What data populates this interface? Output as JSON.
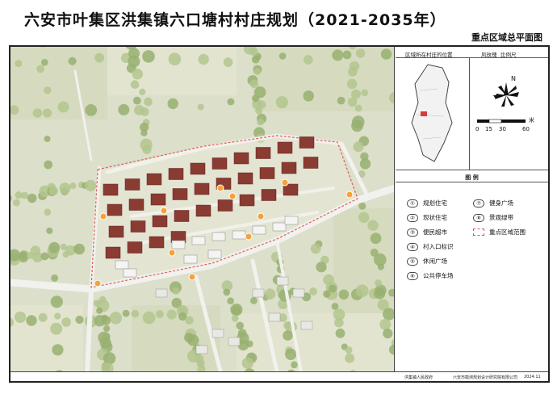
{
  "header": {
    "title": "六安市叶集区洪集镇六口塘村村庄规划（2021-2035年）",
    "subtitle": "重点区域总平面图"
  },
  "panel": {
    "location_label": "区域所在村庄的位置",
    "compass_label": "风玫瑰",
    "scale_label": "比例尺",
    "north_label": "N",
    "scale_ticks": [
      "0",
      "15",
      "30",
      "60"
    ],
    "scale_unit": "米",
    "legend_title": "图  例"
  },
  "legend": [
    {
      "num": "①",
      "label": "规划住宅"
    },
    {
      "num": "②",
      "label": "现状住宅"
    },
    {
      "num": "③",
      "label": "便民超市"
    },
    {
      "num": "④",
      "label": "村入口标识"
    },
    {
      "num": "⑤",
      "label": "休闲广场"
    },
    {
      "num": "⑥",
      "label": "公共停车场"
    },
    {
      "num": "⑦",
      "label": "健身广场"
    },
    {
      "num": "⑧",
      "label": "景观绿带"
    },
    {
      "num": "",
      "label": "重点区域范围"
    }
  ],
  "footer": {
    "left": "洪集镇人民政府",
    "middle": "六安市勘测规划设计研究院有限公司",
    "right": "2024.11"
  },
  "colors": {
    "vegetation": "#a9bf85",
    "field": "#d9dcc3",
    "roof": "#8a3b32",
    "boundary": "#e06060",
    "road": "#ececec"
  }
}
